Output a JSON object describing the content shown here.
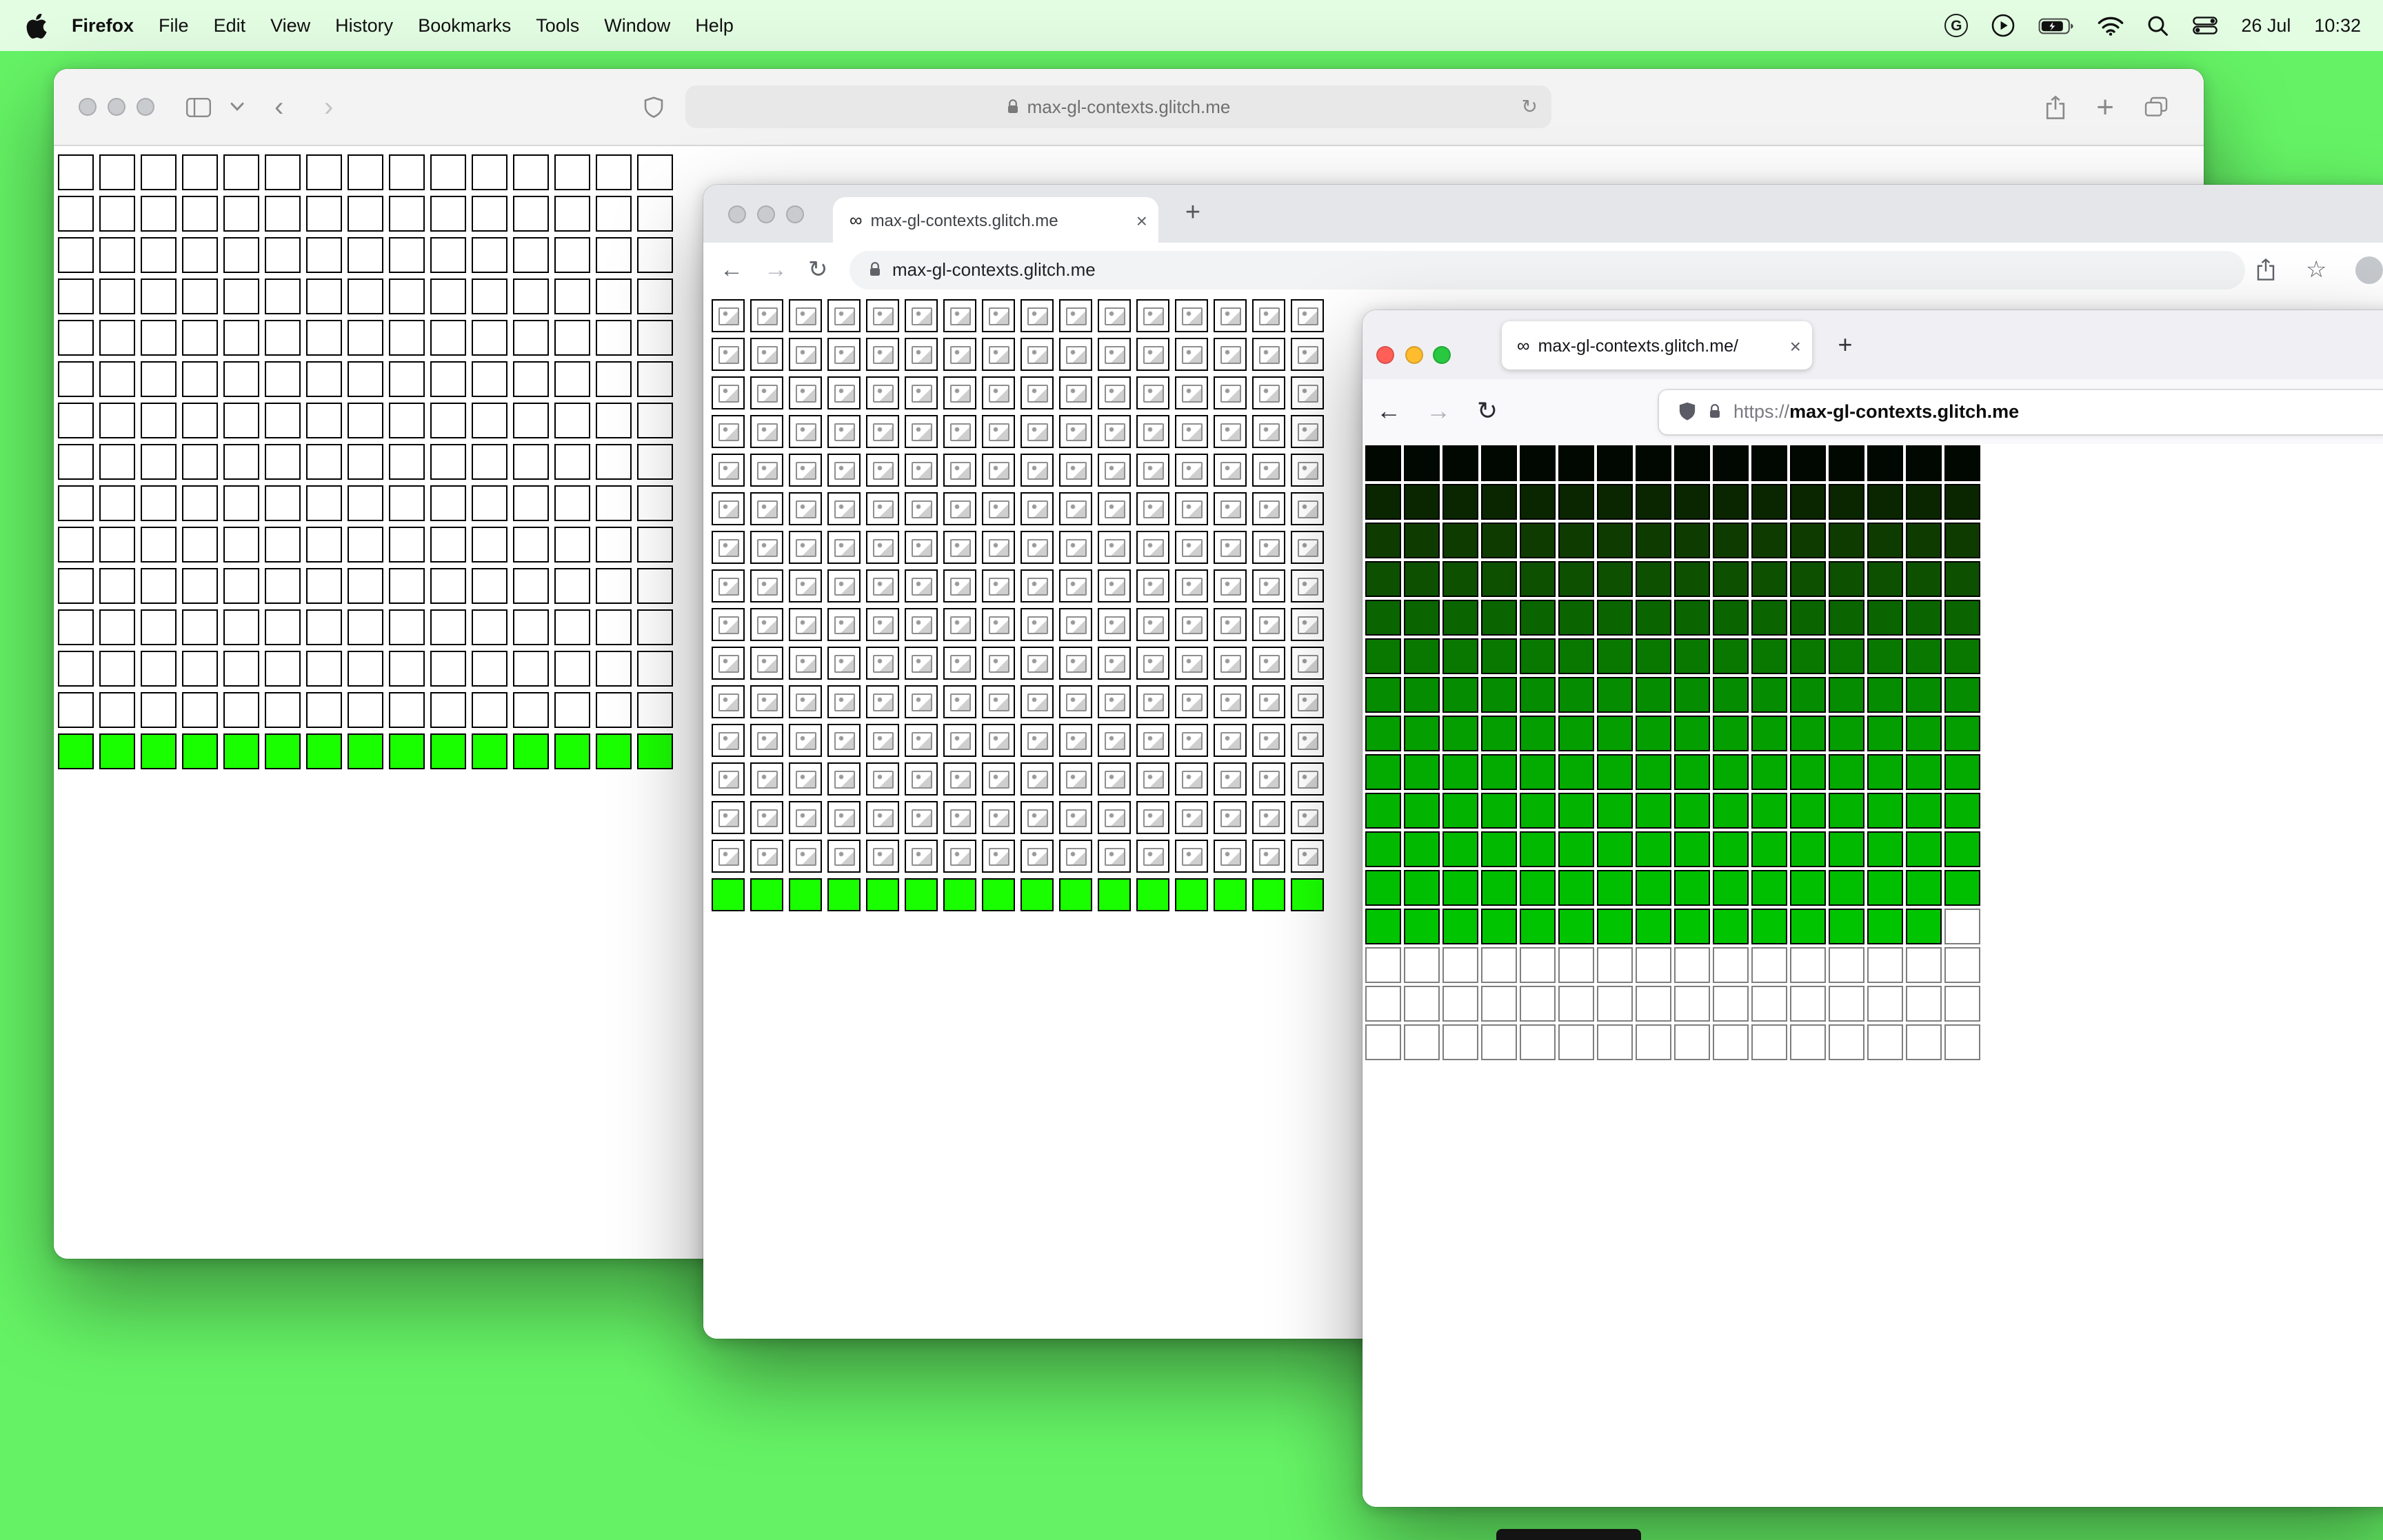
{
  "menu_bar": {
    "app_name": "Firefox",
    "items": [
      "File",
      "Edit",
      "View",
      "History",
      "Bookmarks",
      "Tools",
      "Window",
      "Help"
    ],
    "date": "26 Jul",
    "time": "10:32"
  },
  "icons": {
    "back_chevron": "‹",
    "forward_chevron": "›",
    "back_arrow": "←",
    "forward_arrow": "→",
    "reload": "↻",
    "plus": "+",
    "close": "×",
    "star": "☆",
    "infinity": "∞",
    "grammarly": "G"
  },
  "colors": {
    "desktop": "#65f365",
    "lime": "#1aff00"
  },
  "windows": {
    "safari": {
      "url": "max-gl-contexts.glitch.me",
      "grid": {
        "cols": 15,
        "rows": [
          {
            "fill": "#ffffff",
            "border": "#000000",
            "repeat": 14
          },
          {
            "fill": "#1aff00",
            "border": "#000000",
            "repeat": 1
          }
        ]
      }
    },
    "chrome": {
      "tab_title": "max-gl-contexts.glitch.me",
      "url": "max-gl-contexts.glitch.me",
      "grid": {
        "cols": 16,
        "rows": [
          {
            "fill": "#ffffff",
            "border": "#000000",
            "icon": "broken-image",
            "repeat": 15
          },
          {
            "fill": "#1aff00",
            "border": "#000000",
            "repeat": 1
          }
        ]
      }
    },
    "firefox": {
      "tab_title": "max-gl-contexts.glitch.me/",
      "url_scheme": "https://",
      "url_host": "max-gl-contexts.glitch.me",
      "grid": {
        "cols": 16,
        "rows": [
          {
            "fill": "#010701",
            "border": "#000000"
          },
          {
            "fill": "#0a2600",
            "border": "#000000"
          },
          {
            "fill": "#0e3b00",
            "border": "#000000"
          },
          {
            "fill": "#0c5000",
            "border": "#000000"
          },
          {
            "fill": "#0a6400",
            "border": "#000000"
          },
          {
            "fill": "#087800",
            "border": "#000000"
          },
          {
            "fill": "#068c00",
            "border": "#000000"
          },
          {
            "fill": "#049e00",
            "border": "#000000"
          },
          {
            "fill": "#03aa00",
            "border": "#000000"
          },
          {
            "fill": "#02b300",
            "border": "#000000"
          },
          {
            "fill": "#01ba00",
            "border": "#000000"
          },
          {
            "fill": "#00bf00",
            "border": "#000000"
          },
          {
            "fill": "#00c400",
            "border": "#000000",
            "white_tail": 1
          },
          {
            "fill": "#ffffff",
            "border": "#7e7e7e",
            "repeat": 3
          }
        ]
      }
    }
  }
}
